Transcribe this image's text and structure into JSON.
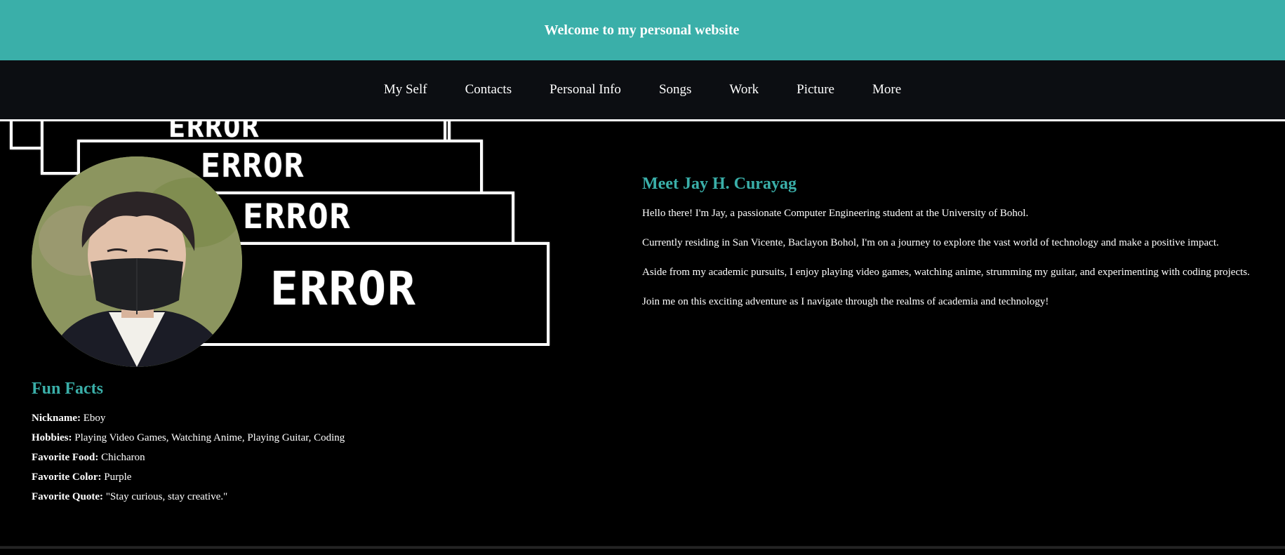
{
  "header": {
    "title": "Welcome to my personal website"
  },
  "nav": {
    "items": [
      {
        "label": "My Self"
      },
      {
        "label": "Contacts"
      },
      {
        "label": "Personal Info"
      },
      {
        "label": "Songs"
      },
      {
        "label": "Work"
      },
      {
        "label": "Picture"
      },
      {
        "label": "More"
      }
    ]
  },
  "decor": {
    "error_text": "ERROR"
  },
  "fun_facts": {
    "title": "Fun Facts",
    "items": [
      {
        "label": "Nickname:",
        "value": "Eboy"
      },
      {
        "label": "Hobbies:",
        "value": "Playing Video Games, Watching Anime, Playing Guitar, Coding"
      },
      {
        "label": "Favorite Food:",
        "value": "Chicharon"
      },
      {
        "label": "Favorite Color:",
        "value": "Purple"
      },
      {
        "label": "Favorite Quote:",
        "value": "\"Stay curious, stay creative.\""
      }
    ]
  },
  "about": {
    "title": "Meet Jay H. Curayag",
    "paragraphs": [
      "Hello there! I'm Jay, a passionate Computer Engineering student at the University of Bohol.",
      "Currently residing in San Vicente, Baclayon Bohol, I'm on a journey to explore the vast world of technology and make a positive impact.",
      "Aside from my academic pursuits, I enjoy playing video games, watching anime, strumming my guitar, and experimenting with coding projects.",
      "Join me on this exciting adventure as I navigate through the realms of academia and technology!"
    ]
  },
  "colors": {
    "accent": "#3aafa9",
    "nav_bg": "#0c0e12",
    "page_bg": "#000000"
  }
}
